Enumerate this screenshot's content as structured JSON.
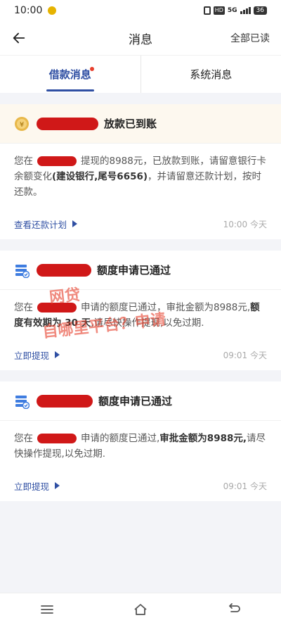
{
  "status_bar": {
    "time": "10:00",
    "network_badge": "HD",
    "signal_label": "5G",
    "battery": "36"
  },
  "header": {
    "title": "消息",
    "action_label": "全部已读"
  },
  "tabs": [
    {
      "label": "借款消息",
      "active": true,
      "has_dot": true
    },
    {
      "label": "系统消息",
      "active": false,
      "has_dot": false
    }
  ],
  "messages": [
    {
      "title": "放款已到账",
      "body_prefix": "您在",
      "body_middle": "提现的8988元，已放款到账，请留意银行卡余额变化",
      "body_bold": "(建设银行,尾号6656)",
      "body_suffix": "，并请留意还款计划，按时还款。",
      "link": "查看还款计划",
      "time": "10:00 今天"
    },
    {
      "title": "额度申请已通过",
      "body_prefix": "您在",
      "body_middle": "申请的额度已通过，审批金额为8988元,",
      "body_bold": "额度有效期为 30 天",
      "body_suffix": ",请尽快操作提现,以免过期.",
      "link": "立即提现",
      "time": "09:01 今天"
    },
    {
      "title": "额度申请已通过",
      "body_prefix": "您在",
      "body_middle": "申请的额度已通过,",
      "body_bold": "审批金额为8988元,",
      "body_suffix": "请尽快操作提现,以免过期.",
      "link": "立即提现",
      "time": "09:01 今天"
    }
  ],
  "watermark": {
    "line1": "网贷",
    "line2": "自哪里平台？申请"
  },
  "colors": {
    "accent": "#2f4fa3",
    "redaction": "#d01818",
    "badge_dot": "#e8402e"
  }
}
